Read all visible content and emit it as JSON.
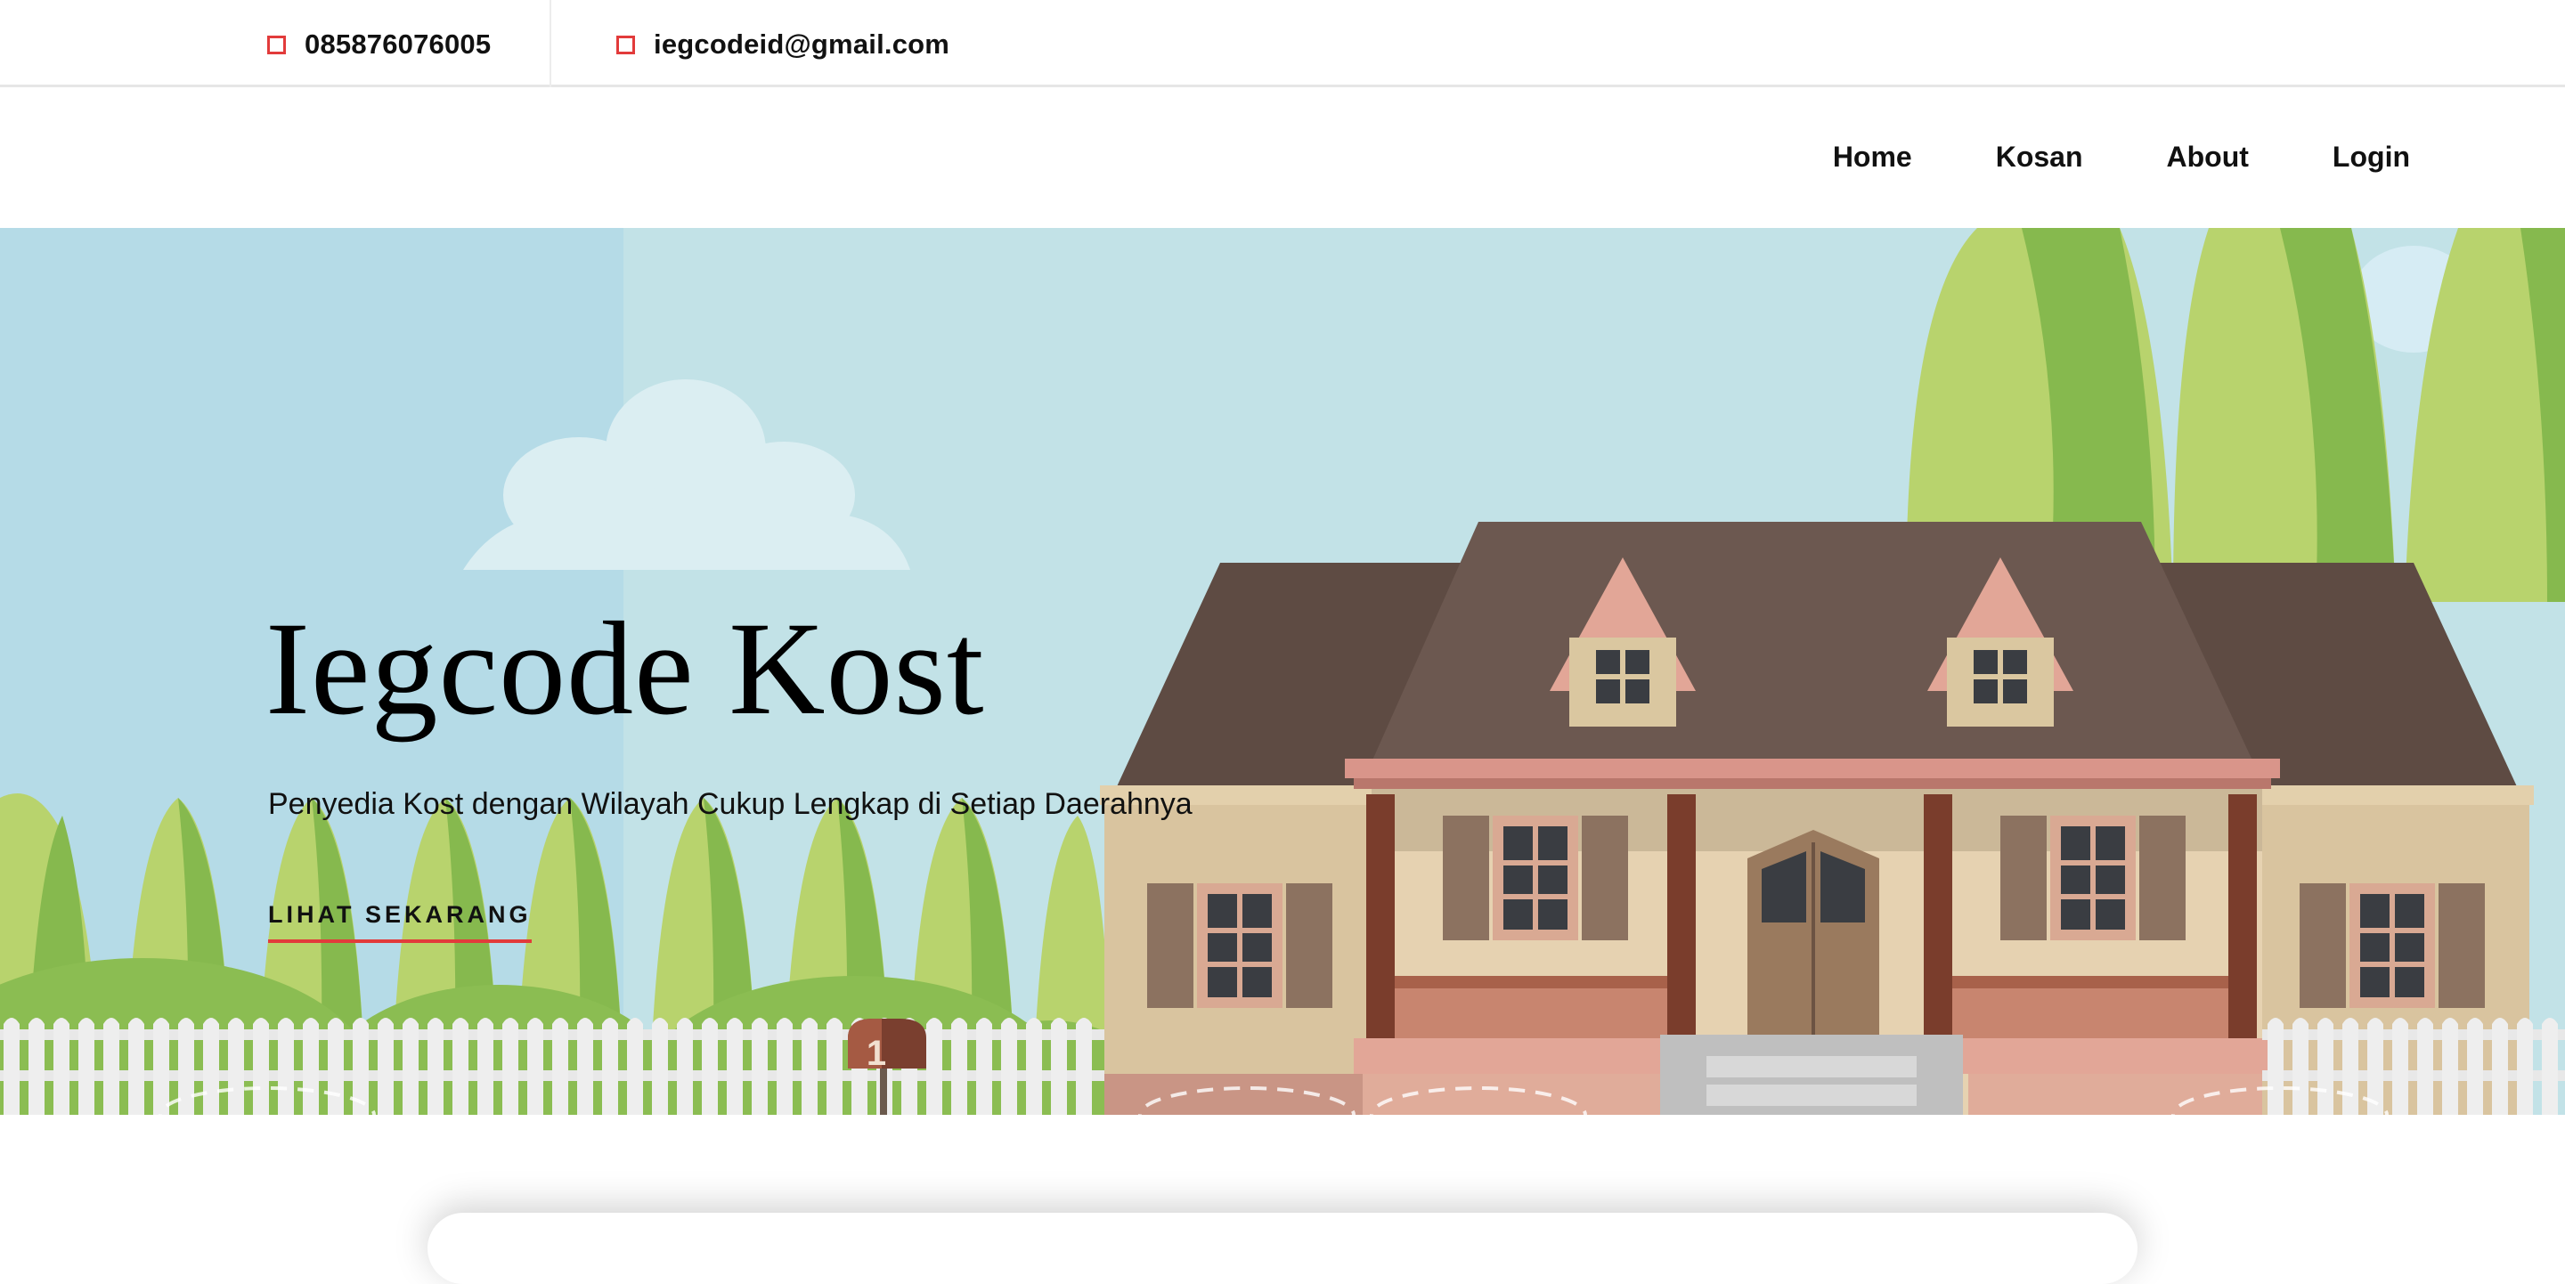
{
  "topbar": {
    "phone": "085876076005",
    "email": "iegcodeid@gmail.com",
    "icon_color": "#e23b3b"
  },
  "nav": {
    "items": [
      {
        "label": "Home"
      },
      {
        "label": "Kosan"
      },
      {
        "label": "About"
      },
      {
        "label": "Login"
      }
    ]
  },
  "hero": {
    "title": "Iegcode Kost",
    "subtitle": "Penyedia Kost dengan Wilayah Cukup Lengkap di Setiap Daerahnya",
    "cta_label": "LIHAT SEKARANG",
    "accent_color": "#e23b3b",
    "mailbox_number": "1"
  }
}
